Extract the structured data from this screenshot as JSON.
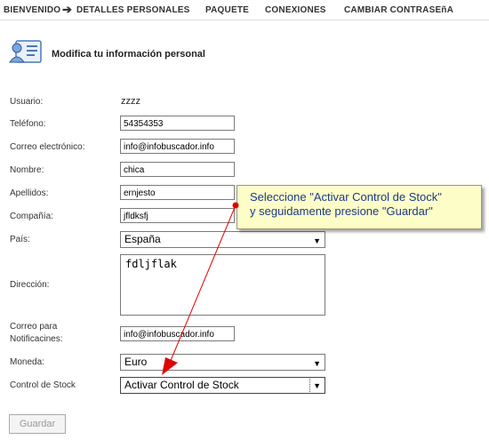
{
  "nav": {
    "items": [
      "BIENVENIDO",
      "DETALLES PERSONALES",
      "PAQUETE",
      "CONEXIONES",
      "CAMBIAR CONTRASEñA"
    ],
    "arrow": "➔"
  },
  "heading": "Modifica tu información personal",
  "form": {
    "usuario": {
      "label": "Usuario:",
      "value": "zzzz"
    },
    "telefono": {
      "label": "Teléfono:",
      "value": "54354353"
    },
    "correo": {
      "label": "Correo electrónico:",
      "value": "info@infobuscador.info"
    },
    "nombre": {
      "label": "Nombre:",
      "value": "chica"
    },
    "apellidos": {
      "label": "Apellidos:",
      "value": "ernjesto"
    },
    "compania": {
      "label": "Compañía:",
      "value": "jfldksfj"
    },
    "pais": {
      "label": "País:",
      "value": "España"
    },
    "direccion": {
      "label": "Dirección:",
      "value": "fdljflak"
    },
    "correo_notif": {
      "label_line1": "Correo para",
      "label_line2": "Notificacines:",
      "value": "info@infobuscador.info"
    },
    "moneda": {
      "label": "Moneda:",
      "value": "Euro"
    },
    "stock": {
      "label": "Control de Stock",
      "value": "Activar Control de Stock"
    }
  },
  "save_label": "Guardar",
  "tooltip": {
    "line1": "Seleccione \"Activar Control de Stock\"",
    "line2": "y seguidamente presione \"Guardar\""
  },
  "colors": {
    "annotation_arrow": "#e00000",
    "tooltip_bg": "#fdfdc8",
    "tooltip_text": "#1a3a8a"
  },
  "icons": {
    "header": "user-card-icon",
    "dropdown": "triangle-down"
  }
}
